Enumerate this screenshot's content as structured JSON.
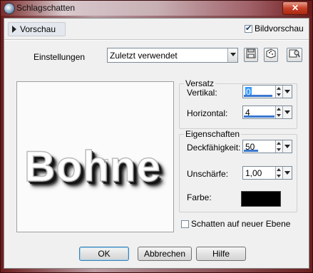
{
  "window": {
    "title": "Schlagschatten",
    "close_symbol": "✕"
  },
  "toolbar": {
    "preview_toggle_label": "Vorschau",
    "image_preview_label": "Bildvorschau",
    "image_preview_checked": true
  },
  "settings": {
    "label": "Einstellungen",
    "value": "Zuletzt verwendet",
    "icons": [
      "save-preset-icon",
      "dice-random-icon",
      "preset-manager-icon"
    ]
  },
  "preview": {
    "sample_text": "Bohne"
  },
  "offset": {
    "title": "Versatz",
    "vertical_label": "Vertikal:",
    "vertical_value": "0",
    "horizontal_label": "Horizontal:",
    "horizontal_value": "4"
  },
  "properties": {
    "title": "Eigenschaften",
    "opacity_label": "Deckfähigkeit:",
    "opacity_value": "50",
    "blur_label": "Unschärfe:",
    "blur_value": "1,00",
    "color_label": "Farbe:",
    "color_value": "#000000"
  },
  "new_layer": {
    "label": "Schatten auf neuer Ebene",
    "checked": false
  },
  "buttons": {
    "ok": "OK",
    "cancel": "Abbrechen",
    "help": "Hilfe"
  },
  "colors": {
    "accent_bar": "#3a78d0",
    "default_button_border": "#3c7fb1"
  }
}
